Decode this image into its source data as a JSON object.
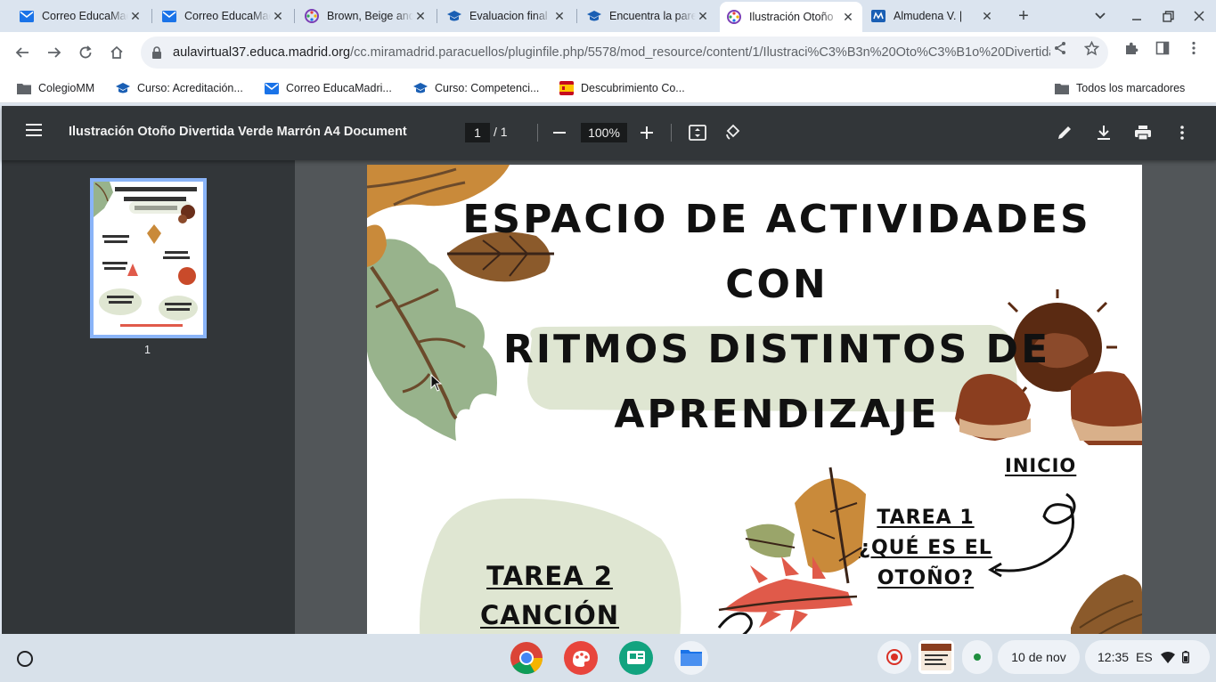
{
  "tabs": [
    {
      "title": "Correo EducaMadrid",
      "icon": "mail-icon"
    },
    {
      "title": "Correo EducaMadrid",
      "icon": "mail-icon"
    },
    {
      "title": "Brown, Beige and White",
      "icon": "canva-icon"
    },
    {
      "title": "Evaluacion final",
      "icon": "moodle-icon"
    },
    {
      "title": "Encuentra la pareja",
      "icon": "moodle-icon"
    },
    {
      "title": "Ilustración Otoño",
      "icon": "canva-icon",
      "active": true
    },
    {
      "title": "Almudena V. | ",
      "icon": "docs-icon"
    }
  ],
  "address": {
    "host": "aulavirtual37.educa.madrid.org",
    "path": "/cc.miramadrid.paracuellos/pluginfile.php/5578/mod_resource/content/1/Ilustraci%C3%B3n%20Oto%C3%B1o%20Divertida%..."
  },
  "bookmarks": [
    {
      "label": "ColegioMM",
      "icon": "folder-icon"
    },
    {
      "label": "Curso: Acreditación...",
      "icon": "moodle-icon"
    },
    {
      "label": "Correo EducaMadri...",
      "icon": "mail-icon"
    },
    {
      "label": "Curso: Competenci...",
      "icon": "moodle-icon"
    },
    {
      "label": "Descubrimiento Co...",
      "icon": "spain-flag-icon"
    }
  ],
  "bookmarks_right": {
    "label": "Todos los marcadores",
    "icon": "folder-icon"
  },
  "pdf": {
    "title": "Ilustración Otoño Divertida Verde Marrón A4 Document",
    "page_current": "1",
    "page_total": "/  1",
    "zoom": "100%",
    "thumb_label": "1"
  },
  "poster": {
    "title_lines": [
      "ESPACIO DE ACTIVIDADES CON",
      "RITMOS DISTINTOS DE",
      "APRENDIZAJE"
    ],
    "inicio": "INICIO",
    "tarea1": [
      "TAREA 1",
      "¿QUÉ ES EL",
      "OTOÑO?"
    ],
    "tarea2": [
      "TAREA 2",
      "CANCIÓN DEL"
    ]
  },
  "shelf": {
    "date": "10 de nov",
    "time": "12:35",
    "lang": "ES"
  },
  "colors": {
    "accent": "#1a73e8",
    "pdf_toolbar": "#323639",
    "pdf_bg": "#525659",
    "blob": "#dfe6d2",
    "leaf_brown": "#8b5a2b",
    "leaf_orange": "#c98a3a",
    "leaf_green": "#98b38c",
    "leaf_red": "#e05a4a"
  }
}
